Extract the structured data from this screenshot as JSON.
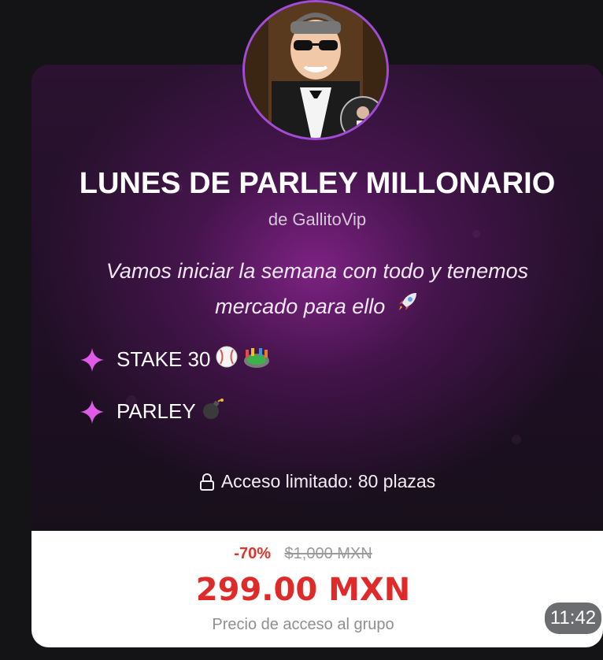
{
  "card": {
    "title": "LUNES DE PARLEY MILLONARIO",
    "author": "de GallitoVip",
    "description_line1": "Vamos iniciar la semana con todo y tenemos",
    "description_line2": "mercado para ello",
    "description_icon": "rocket-icon",
    "bullets": [
      {
        "text": "STAKE 30",
        "icons": [
          "baseball-icon",
          "stadium-icon"
        ]
      },
      {
        "text": "PARLEY",
        "icons": [
          "bomb-icon"
        ]
      }
    ],
    "access_text": "Acceso limitado: 80 plazas",
    "access_icon": "lock-icon"
  },
  "pricing": {
    "discount": "-70%",
    "old_price": "$1,000 MXN",
    "price": "299.00 MXN",
    "note": "Precio de acceso al grupo"
  },
  "message": {
    "time": "11:42"
  },
  "colors": {
    "accent": "#a24bd6",
    "sparkle": "#e05ae8",
    "price_red": "#df2a2a"
  }
}
